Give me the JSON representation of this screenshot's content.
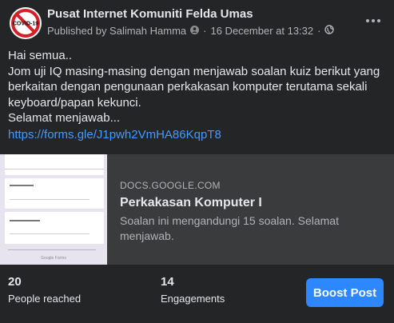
{
  "post": {
    "page_name": "Pusat Internet Komuniti Felda Umas",
    "avatar_text": "COVID-19",
    "published_by": "Published by Salimah Hamma",
    "date": "16 December at 13:32",
    "separator": "·",
    "text_lines": [
      "Hai semua..",
      "Jom uji IQ masing-masing dengan menjawab soalan kuiz berikut yang",
      "berkaitan dengan pengunaan perkakasan komputer terutama sekali",
      "keyboard/papan kekunci.",
      "Selamat menjawab..."
    ],
    "link_url": "https://forms.gle/J1pwh2VmHA86KqpT8"
  },
  "link_card": {
    "domain": "DOCS.GOOGLE.COM",
    "title": "Perkakasan Komputer I",
    "description": "Soalan ini mengandungi 15 soalan. Selamat menjawab.",
    "thumbnail_footer": "Google Forms"
  },
  "stats": {
    "reach": {
      "number": "20",
      "label": "People reached"
    },
    "engagements": {
      "number": "14",
      "label": "Engagements"
    }
  },
  "boost_button_label": "Boost Post",
  "icons": {
    "more": "more-horizontal-icon",
    "privacy": "globe-icon",
    "author_badge": "profile-badge-icon"
  },
  "colors": {
    "background": "#242526",
    "card": "#3a3b3c",
    "link": "#4599ff",
    "button": "#2d88ff",
    "secondary_text": "#b0b3b8"
  }
}
